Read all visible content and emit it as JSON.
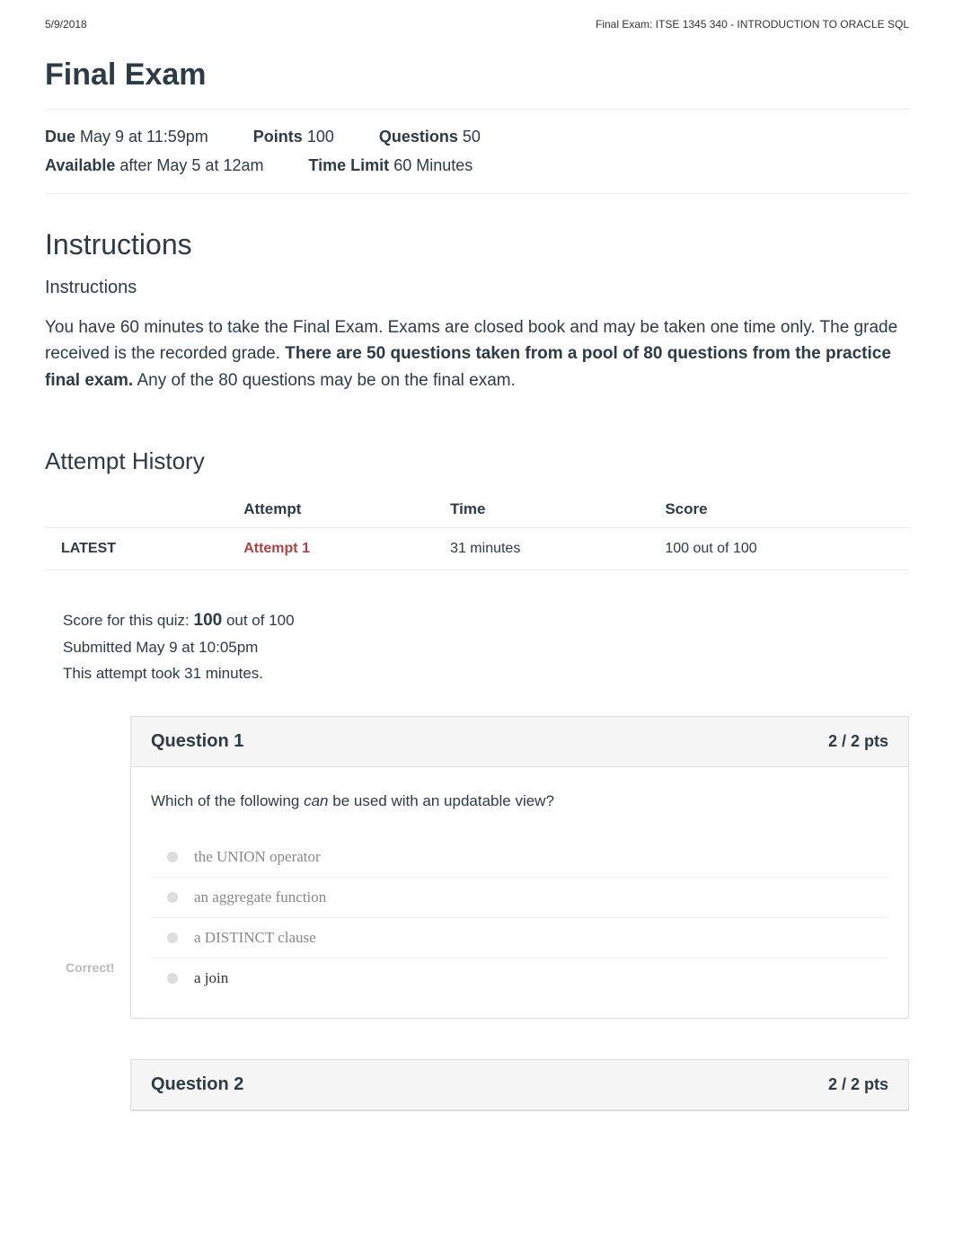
{
  "header": {
    "date": "5/9/2018",
    "title": "Final Exam: ITSE 1345 340 - INTRODUCTION TO ORACLE SQL"
  },
  "page": {
    "title": "Final Exam"
  },
  "meta": {
    "due_label": "Due",
    "due_value": "May 9 at 11:59pm",
    "points_label": "Points",
    "points_value": "100",
    "questions_label": "Questions",
    "questions_value": "50",
    "available_label": "Available",
    "available_value": "after May 5 at 12am",
    "timelimit_label": "Time Limit",
    "timelimit_value": "60 Minutes"
  },
  "instructions": {
    "heading": "Instructions",
    "subheading": "Instructions",
    "body_1": "You have 60 minutes to take the Final Exam. Exams are closed book and may be taken one time only. The grade received is the recorded grade.   ",
    "body_bold": "There are 50 questions taken from a pool of 80 questions from the practice final exam.",
    "body_3": "  Any of the 80 questions may be on the final exam."
  },
  "attempt_history": {
    "heading": "Attempt History",
    "columns": {
      "blank": "",
      "attempt": "Attempt",
      "time": "Time",
      "score": "Score"
    },
    "rows": [
      {
        "latest": "LATEST",
        "attempt": "Attempt 1",
        "time": "31 minutes",
        "score": "100 out of 100"
      }
    ]
  },
  "score_summary": {
    "prefix": "Score for this quiz: ",
    "score": "100",
    "suffix": " out of 100",
    "submitted": "Submitted May 9 at 10:05pm",
    "duration": "This attempt took 31 minutes."
  },
  "questions": [
    {
      "title": "Question 1",
      "points": "2 / 2 pts",
      "text_1": "Which of the following ",
      "text_italic": "can",
      "text_2": " be used with an updatable view?",
      "answers": [
        {
          "text": "the UNION operator",
          "correct": false
        },
        {
          "text": "an aggregate function",
          "correct": false
        },
        {
          "text": "a DISTINCT clause",
          "correct": false
        },
        {
          "text": "a join",
          "correct": true
        }
      ],
      "correct_label": "Correct!"
    },
    {
      "title": "Question 2",
      "points": "2 / 2 pts"
    }
  ]
}
